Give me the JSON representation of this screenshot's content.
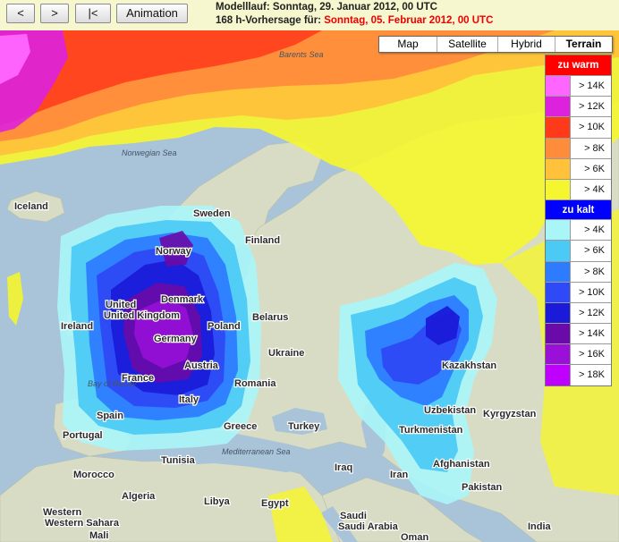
{
  "toolbar": {
    "prev_label": "<",
    "next_label": ">",
    "first_label": "|<",
    "animation_label": "Animation"
  },
  "run_info": {
    "model_run_label": "Modelllauf: ",
    "model_run_value": "Sonntag, 29. Januar 2012, 00 UTC",
    "forecast_label": "168 h-Vorhersage für: ",
    "forecast_value": "Sonntag, 05. Februar 2012, 00 UTC"
  },
  "map_types": [
    {
      "label": "Map",
      "active": false
    },
    {
      "label": "Satellite",
      "active": false
    },
    {
      "label": "Hybrid",
      "active": false
    },
    {
      "label": "Terrain",
      "active": true
    }
  ],
  "legend": {
    "warm_title": "zu warm",
    "warm_title_color": "#ff0000",
    "warm": [
      {
        "label": "> 14K",
        "color": "#ff66ff"
      },
      {
        "label": "> 12K",
        "color": "#dd22dd"
      },
      {
        "label": "> 10K",
        "color": "#ff3a1a"
      },
      {
        "label": "> 8K",
        "color": "#ff8c3a"
      },
      {
        "label": "> 6K",
        "color": "#ffc23a"
      },
      {
        "label": "> 4K",
        "color": "#f5f530"
      }
    ],
    "cold_title": "zu kalt",
    "cold_title_color": "#0000ff",
    "cold": [
      {
        "label": "> 4K",
        "color": "#aaf5f8"
      },
      {
        "label": "> 6K",
        "color": "#4ccaf6"
      },
      {
        "label": "> 8K",
        "color": "#2d7cff"
      },
      {
        "label": "> 10K",
        "color": "#2e49f5"
      },
      {
        "label": "> 12K",
        "color": "#1a1ad8"
      },
      {
        "label": "> 14K",
        "color": "#6a0aa8"
      },
      {
        "label": "> 16K",
        "color": "#9a10d8"
      },
      {
        "label": "> 18K",
        "color": "#c000ff"
      }
    ]
  },
  "map_labels": {
    "barents_sea": "Barents Sea",
    "norwegian_sea": "Norwegian Sea",
    "bay_of_biscay": "Bay of Biscay",
    "mediterranean": "Mediterranean Sea",
    "iceland": "Iceland",
    "sweden": "Sweden",
    "finland": "Finland",
    "norway": "Norway",
    "denmark": "Denmark",
    "united_kingdom": "United Kingdom",
    "ireland": "Ireland",
    "belarus": "Belarus",
    "poland": "Poland",
    "germany": "Germany",
    "ukraine": "Ukraine",
    "austria": "Austria",
    "france": "France",
    "romania": "Romania",
    "italy": "Italy",
    "spain": "Spain",
    "portugal": "Portugal",
    "greece": "Greece",
    "turkey": "Turkey",
    "kazakhstan": "Kazakhstan",
    "uzbekistan": "Uzbekistan",
    "kyrgyzstan": "Kyrgyzstan",
    "turkmenistan": "Turkmenistan",
    "afghanistan": "Afghanistan",
    "pakistan": "Pakistan",
    "iraq": "Iraq",
    "iran": "Iran",
    "morocco": "Morocco",
    "tunisia": "Tunisia",
    "algeria": "Algeria",
    "libya": "Libya",
    "egypt": "Egypt",
    "saudi_arabia": "Saudi Arabia",
    "western_sahara": "Western Sahara",
    "mali": "Mali",
    "oman": "Oman",
    "india": "India"
  }
}
